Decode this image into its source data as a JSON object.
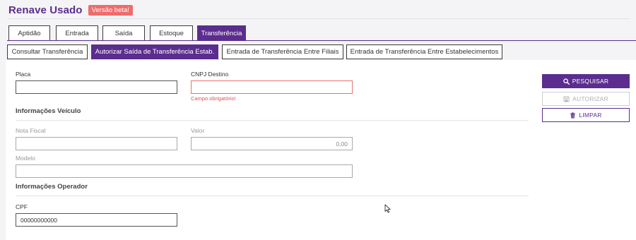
{
  "header": {
    "title": "Renave Usado",
    "badge": "Versão beta!"
  },
  "main_tabs": [
    {
      "label": "Aptidão"
    },
    {
      "label": "Entrada"
    },
    {
      "label": "Saída"
    },
    {
      "label": "Estoque"
    },
    {
      "label": "Transferência",
      "active": true
    }
  ],
  "sub_tabs": [
    {
      "label": "Consultar Transferência"
    },
    {
      "label": "Autorizar Saída de Transferência Estab.",
      "active": true
    },
    {
      "label": "Entrada de Transferência Entre Filiais"
    },
    {
      "label": "Entrada de Transferência Entre Estabelecimentos"
    }
  ],
  "form": {
    "placa": {
      "label": "Placa",
      "value": ""
    },
    "cnpj_destino": {
      "label": "CNPJ Destino",
      "value": "",
      "error": "Campo obrigatório!"
    },
    "section_veiculo": "Informações Veículo",
    "nota_fiscal": {
      "label": "Nota Fiscal",
      "value": ""
    },
    "valor": {
      "label": "Valor",
      "value": "0,00"
    },
    "modelo": {
      "label": "Modelo",
      "value": ""
    },
    "section_operador": "Informações Operador",
    "cpf": {
      "label": "CPF",
      "value": "00000000000"
    }
  },
  "actions": {
    "search_label": "PESQUISAR",
    "authorize_label": "AUTORIZAR",
    "clear_label": "LIMPAR"
  },
  "colors": {
    "brand": "#5b2d8e",
    "badge": "#f26b6b",
    "error": "#e05252"
  }
}
